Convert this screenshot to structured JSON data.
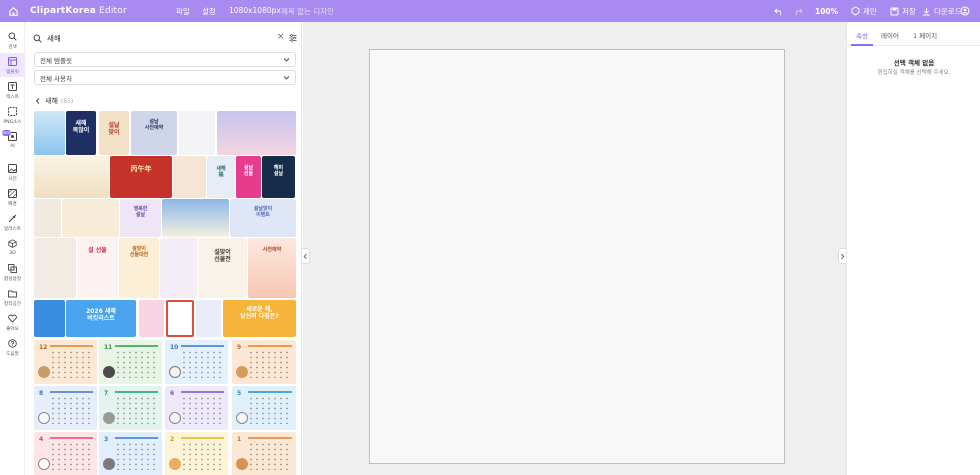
{
  "app": {
    "title": "ClipartKorea",
    "title_suffix": "Editor",
    "menu_file": "파일",
    "menu_settings": "설정",
    "canvas_size": "1080x1080px",
    "doc_name": "제목 없는 디자인",
    "zoom": "100%",
    "suggest_label": "제안",
    "save_label": "저장",
    "download_label": "다운로드",
    "accent_color": "#a98af0"
  },
  "rail": {
    "items": [
      {
        "label": "검색",
        "icon": "search-icon"
      },
      {
        "label": "템플릿",
        "icon": "template-icon"
      },
      {
        "label": "텍스트",
        "icon": "text-icon"
      },
      {
        "label": "PNG소스",
        "icon": "png-source-icon"
      },
      {
        "label": "AI",
        "icon": "ai-icon"
      },
      {
        "label": "사진",
        "icon": "photo-icon"
      },
      {
        "label": "배경",
        "icon": "background-icon"
      },
      {
        "label": "일러스트",
        "icon": "illustration-icon"
      },
      {
        "label": "3D",
        "icon": "cube-icon"
      },
      {
        "label": "합성용컷",
        "icon": "composite-icon"
      },
      {
        "label": "창작공간",
        "icon": "folder-icon"
      },
      {
        "label": "좋아요",
        "icon": "heart-icon"
      },
      {
        "label": "도움말",
        "icon": "help-icon"
      }
    ],
    "new_badge": "NEW"
  },
  "panel": {
    "search_value": "새해",
    "filter1": "전체 템플릿",
    "filter2": "전체 사용처",
    "section_title": "새해",
    "section_count": "(65)"
  },
  "thumb_texts": {
    "t2": "새해\n복많이",
    "t3": "설날\n맞이",
    "t4": "설날\n사전예약",
    "t10": "丙午年",
    "t12": "새해\n福",
    "t13": "설날\n선물",
    "t14": "해피\n설날",
    "t19": "행복한\n설날",
    "t21": "설날맞이\n이벤트",
    "t23": "설 선물",
    "t24": "설맞이\n선물대전",
    "t26": "설맞이\n선물전",
    "t27": "사전예약",
    "t30": "2026 새해\n버킷리스트",
    "t35": "새로운 해,\n당신의 다짐은?"
  },
  "calendars": [
    {
      "num": "12"
    },
    {
      "num": "11"
    },
    {
      "num": "10"
    },
    {
      "num": "9"
    },
    {
      "num": "8"
    },
    {
      "num": "7"
    },
    {
      "num": "6"
    },
    {
      "num": "5"
    },
    {
      "num": "4"
    },
    {
      "num": "3"
    },
    {
      "num": "2"
    },
    {
      "num": "1"
    }
  ],
  "right_panel": {
    "tab_properties": "속성",
    "tab_layers": "레이어",
    "tab_page": "1 페이지",
    "empty_title": "선택 객체 없음",
    "empty_sub": "편집하실 객체를 선택해 주세요."
  }
}
